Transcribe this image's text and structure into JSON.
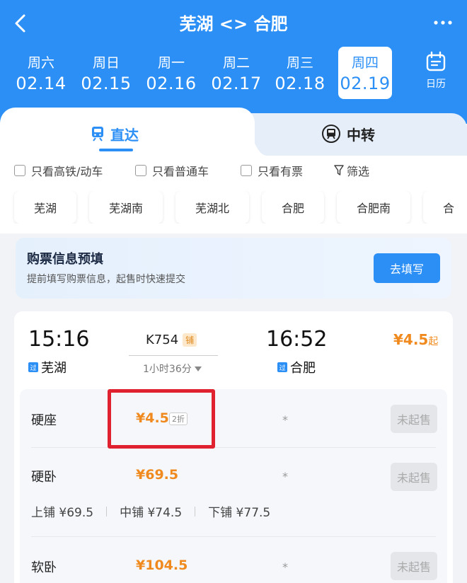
{
  "header": {
    "title": "芜湖 <> 合肥",
    "dates": [
      {
        "weekday": "周六",
        "date": "02.14"
      },
      {
        "weekday": "周日",
        "date": "02.15"
      },
      {
        "weekday": "周一",
        "date": "02.16"
      },
      {
        "weekday": "周二",
        "date": "02.17"
      },
      {
        "weekday": "周三",
        "date": "02.18"
      },
      {
        "weekday": "周四",
        "date": "02.19"
      }
    ],
    "calendar_label": "日历"
  },
  "tabs": {
    "direct": "直达",
    "transfer": "中转"
  },
  "filters": {
    "gaotie": "只看高铁/动车",
    "putong": "只看普通车",
    "youpiao": "只看有票",
    "shaixuan": "筛选"
  },
  "stations": [
    "芜湖",
    "芜湖南",
    "芜湖北",
    "合肥",
    "合肥南",
    "合"
  ],
  "banner": {
    "title": "购票信息预填",
    "subtitle": "提前填写购票信息，起售时快速提交",
    "button": "去填写"
  },
  "train": {
    "depart_time": "15:16",
    "depart_station": "芜湖",
    "arrive_time": "16:52",
    "arrive_station": "合肥",
    "train_no": "K754",
    "sleeper_tag": "铺",
    "duration": "1小时36分",
    "pass_tag": "过",
    "min_price": "¥4.5",
    "min_suffix": "起",
    "seats": [
      {
        "name": "硬座",
        "price": "¥4.5",
        "discount": "2折",
        "star": "*",
        "action": "未起售"
      },
      {
        "name": "硬卧",
        "price": "¥69.5",
        "star": "*",
        "action": "未起售"
      },
      {
        "name": "软卧",
        "price": "¥104.5",
        "star": "*",
        "action": "未起售"
      }
    ],
    "berths": {
      "upper": "上铺 ¥69.5",
      "middle": "中铺 ¥74.5",
      "lower": "下铺 ¥77.5"
    }
  },
  "colors": {
    "brand": "#2c8ff6",
    "price": "#f08a1e",
    "highlight": "#e0212f"
  }
}
